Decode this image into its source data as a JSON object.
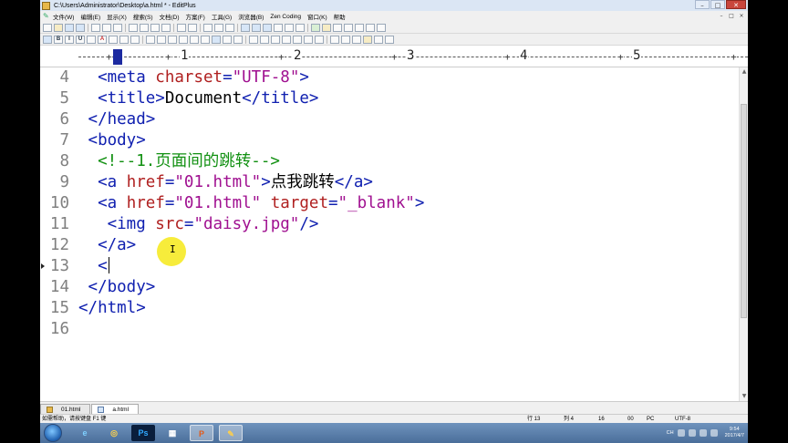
{
  "window": {
    "title": "C:\\Users\\Administrator\\Desktop\\a.html * - EditPlus",
    "buttons": {
      "minimize": "–",
      "maximize": "□",
      "close": "✕"
    }
  },
  "menu": {
    "items": [
      "文件(W)",
      "编辑(E)",
      "显示(X)",
      "搜索(S)",
      "文档(D)",
      "方案(F)",
      "工具(G)",
      "浏览器(B)",
      "Zen Coding",
      "窗口(K)",
      "帮助"
    ],
    "right_buttons": [
      "–",
      "□",
      "×"
    ]
  },
  "ruler": {
    "numbers": [
      "1",
      "2",
      "3",
      "4",
      "5"
    ]
  },
  "editor": {
    "lines": [
      {
        "num": "4",
        "tokens": [
          {
            "t": "tag",
            "v": "  <meta "
          },
          {
            "t": "attr",
            "v": "charset"
          },
          {
            "t": "tag",
            "v": "="
          },
          {
            "t": "val",
            "v": "\"UTF-8\""
          },
          {
            "t": "tag",
            "v": ">"
          }
        ]
      },
      {
        "num": "5",
        "tokens": [
          {
            "t": "tag",
            "v": "  <title>"
          },
          {
            "t": "txt",
            "v": "Document"
          },
          {
            "t": "tag",
            "v": "</title>"
          }
        ]
      },
      {
        "num": "6",
        "tokens": [
          {
            "t": "tag",
            "v": " </head>"
          }
        ]
      },
      {
        "num": "7",
        "tokens": [
          {
            "t": "tag",
            "v": " <body>"
          }
        ]
      },
      {
        "num": "8",
        "tokens": [
          {
            "t": "cmt",
            "v": "  <!--1.页面间的跳转-->"
          }
        ]
      },
      {
        "num": "9",
        "tokens": [
          {
            "t": "tag",
            "v": "  <a "
          },
          {
            "t": "attr",
            "v": "href"
          },
          {
            "t": "tag",
            "v": "="
          },
          {
            "t": "val",
            "v": "\"01.html\""
          },
          {
            "t": "tag",
            "v": ">"
          },
          {
            "t": "txt",
            "v": "点我跳转"
          },
          {
            "t": "tag",
            "v": "</a>"
          }
        ]
      },
      {
        "num": "10",
        "tokens": [
          {
            "t": "tag",
            "v": "  <a "
          },
          {
            "t": "attr",
            "v": "href"
          },
          {
            "t": "tag",
            "v": "="
          },
          {
            "t": "val",
            "v": "\"01.html\""
          },
          {
            "t": "tag",
            "v": " "
          },
          {
            "t": "attr",
            "v": "target"
          },
          {
            "t": "tag",
            "v": "="
          },
          {
            "t": "val",
            "v": "\"_blank\""
          },
          {
            "t": "tag",
            "v": ">"
          }
        ]
      },
      {
        "num": "11",
        "tokens": [
          {
            "t": "tag",
            "v": "   <img "
          },
          {
            "t": "attr",
            "v": "src"
          },
          {
            "t": "tag",
            "v": "="
          },
          {
            "t": "val",
            "v": "\"daisy.jpg\""
          },
          {
            "t": "tag",
            "v": "/>"
          }
        ]
      },
      {
        "num": "12",
        "tokens": [
          {
            "t": "tag",
            "v": "  </a>"
          }
        ]
      },
      {
        "num": "13",
        "tokens": [
          {
            "t": "tag",
            "v": "  <"
          }
        ],
        "caret": true,
        "marker": true
      },
      {
        "num": "14",
        "tokens": [
          {
            "t": "tag",
            "v": " </body>"
          }
        ]
      },
      {
        "num": "15",
        "tokens": [
          {
            "t": "tag",
            "v": "</html>"
          }
        ]
      },
      {
        "num": "16",
        "tokens": []
      }
    ]
  },
  "tabs": [
    {
      "label": "01.html",
      "active": false
    },
    {
      "label": "a.html",
      "active": true
    }
  ],
  "status": {
    "help": "如需帮助，请按键盘 F1 键",
    "row": "行 13",
    "col": "列 4",
    "count": "16",
    "extra": "00",
    "mode": "PC",
    "encoding": "UTF-8"
  },
  "taskbar": {
    "apps": [
      "e",
      "◎",
      "Ps",
      "▦",
      "P",
      "✎"
    ],
    "tray_text": "CH",
    "time": "9:54",
    "date": "2017/4/7"
  },
  "colors": {
    "tag": "#1020b0",
    "attr": "#b02020",
    "value": "#a01090",
    "comment": "#119011",
    "cursor_highlight": "#f6ea2a"
  }
}
